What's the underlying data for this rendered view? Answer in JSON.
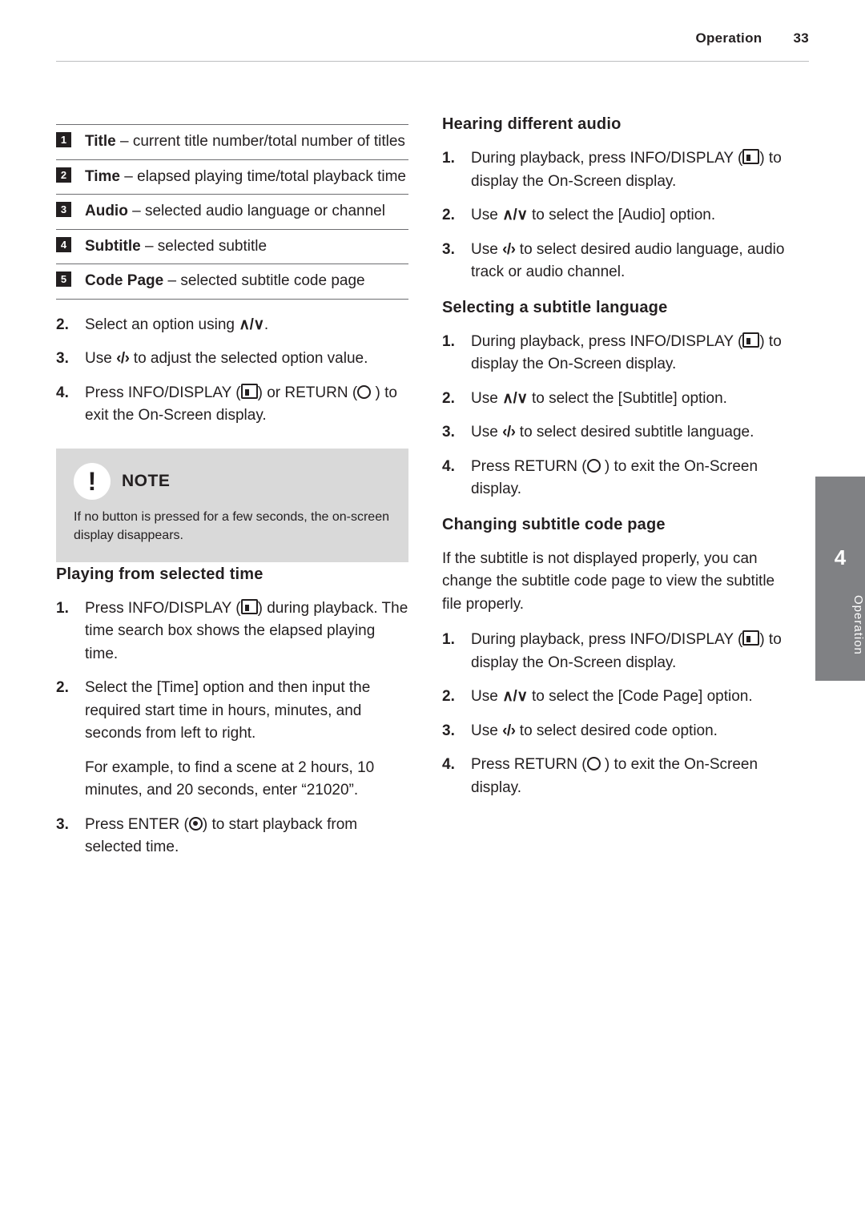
{
  "header": {
    "chapter": "Operation",
    "page_number": "33"
  },
  "side_tab": {
    "number": "4",
    "label": "Operation"
  },
  "left_column": {
    "legend": [
      {
        "badge": "1",
        "term": "Title",
        "desc": " – current title number/total number of titles"
      },
      {
        "badge": "2",
        "term": "Time",
        "desc": " – elapsed playing time/total playback time"
      },
      {
        "badge": "3",
        "term": "Audio",
        "desc": " – selected audio language or channel"
      },
      {
        "badge": "4",
        "term": "Subtitle",
        "desc": " – selected subtitle"
      },
      {
        "badge": "5",
        "term": "Code Page",
        "desc": " – selected subtitle code page"
      }
    ],
    "steps": [
      {
        "num": "2.",
        "text_before": "Select an option using ",
        "arrows": "∧/∨",
        "text_after": "."
      },
      {
        "num": "3.",
        "text_before": "Use ",
        "arrows": "‹/›",
        "text_after": " to adjust the selected option value."
      },
      {
        "num": "4.",
        "text_before": "Press INFO/DISPLAY (",
        "icon1": "info-display-icon",
        "text_mid": ") or RETURN (",
        "icon2": "return-icon",
        "text_after": " ) to exit the On-Screen display."
      }
    ],
    "note": {
      "icon": "exclamation-icon",
      "icon_glyph": "!",
      "title": "NOTE",
      "body": "If no button is pressed for a few seconds, the on-screen display disappears."
    },
    "section_playing_time": {
      "title": "Playing from selected time",
      "steps": [
        {
          "num": "1.",
          "text_before": "Press INFO/DISPLAY (",
          "icon1": "info-display-icon",
          "text_after": ") during playback. The time search box shows the elapsed playing time."
        },
        {
          "num": "2.",
          "text": "Select the [Time] option and then input the required start time in hours, minutes, and seconds from left to right."
        },
        {
          "num": "",
          "text": "For example, to find a scene at 2 hours, 10 minutes, and 20 seconds, enter “21020”."
        },
        {
          "num": "3.",
          "text_before": "Press ENTER (",
          "icon1": "enter-icon",
          "text_after": ") to start playback from selected time."
        }
      ]
    }
  },
  "right_column": {
    "section_audio": {
      "title": "Hearing different audio",
      "steps": [
        {
          "num": "1.",
          "text_before": "During playback, press INFO/DISPLAY (",
          "icon1": "info-display-icon",
          "text_after": ") to display the On-Screen display."
        },
        {
          "num": "2.",
          "text_before": "Use ",
          "arrows": "∧/∨",
          "text_after": " to select the [Audio] option."
        },
        {
          "num": "3.",
          "text_before": "Use ",
          "arrows": "‹/›",
          "text_after": " to select desired audio language, audio track or audio channel."
        }
      ]
    },
    "section_subtitle": {
      "title": "Selecting a subtitle language",
      "steps": [
        {
          "num": "1.",
          "text_before": "During playback, press INFO/DISPLAY (",
          "icon1": "info-display-icon",
          "text_after": ") to display the On-Screen display."
        },
        {
          "num": "2.",
          "text_before": "Use ",
          "arrows": "∧/∨",
          "text_after": " to select the [Subtitle] option."
        },
        {
          "num": "3.",
          "text_before": "Use ",
          "arrows": "‹/›",
          "text_after": " to select desired subtitle language."
        },
        {
          "num": "4.",
          "text_before": "Press RETURN (",
          "icon1": "return-icon",
          "text_after": " ) to exit the On-Screen display."
        }
      ]
    },
    "section_codepage": {
      "title": "Changing subtitle code page",
      "intro": "If the subtitle is not displayed properly, you can change the subtitle code page to view the subtitle file properly.",
      "steps": [
        {
          "num": "1.",
          "text_before": "During playback, press INFO/DISPLAY (",
          "icon1": "info-display-icon",
          "text_after": ") to display the On-Screen display."
        },
        {
          "num": "2.",
          "text_before": "Use ",
          "arrows": "∧/∨",
          "text_after": " to select the [Code Page] option."
        },
        {
          "num": "3.",
          "text_before": "Use ",
          "arrows": "‹/›",
          "text_after": " to select desired code option."
        },
        {
          "num": "4.",
          "text_before": "Press RETURN (",
          "icon1": "return-icon",
          "text_after": " ) to exit the On-Screen display."
        }
      ]
    }
  }
}
